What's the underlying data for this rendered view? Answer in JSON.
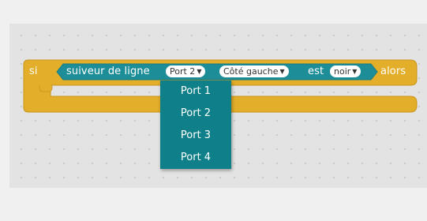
{
  "block": {
    "if_label": "si",
    "then_label": "alors",
    "sensor_label": "suiveur de ligne",
    "est_label": "est",
    "port_value": "Port 2",
    "side_value": "Côté gauche",
    "color_value": "noir"
  },
  "dropdown": {
    "options": [
      "Port 1",
      "Port 2",
      "Port 3",
      "Port 4"
    ]
  },
  "colors": {
    "control_block": "#e3ae29",
    "sensor_block": "#1d8e98",
    "dropdown_bg": "#0f808a",
    "workspace_bg": "#e3e3e3"
  },
  "icons": {
    "caret": "▼"
  }
}
